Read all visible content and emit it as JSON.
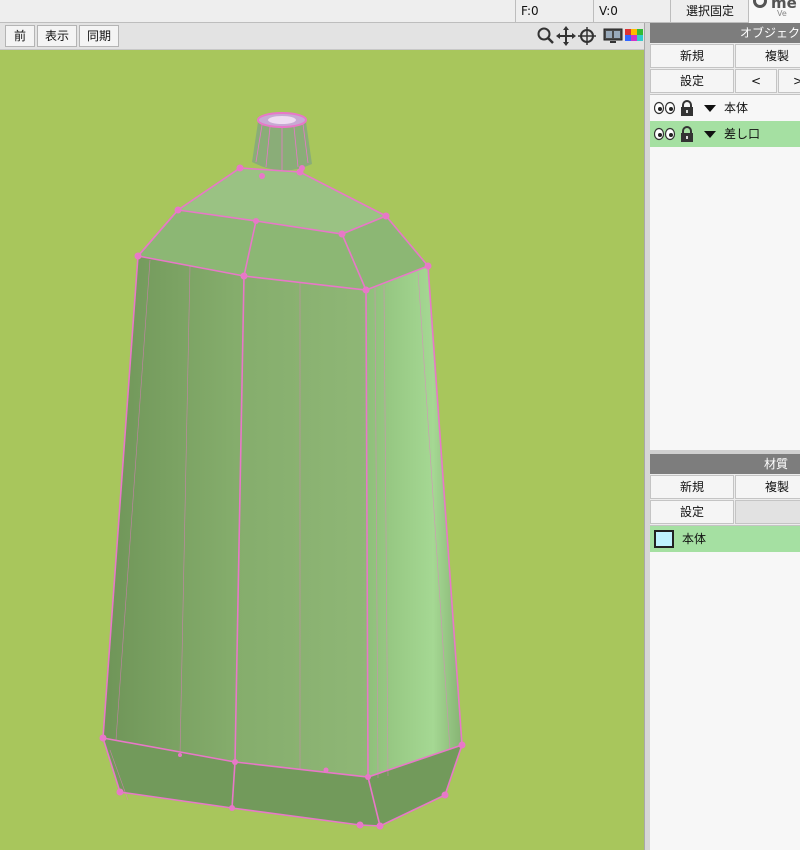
{
  "status_bar": {
    "faces": "F:0",
    "vertices": "V:0",
    "select_lock": "選択固定",
    "logo_text": "me",
    "logo_sub": "Ve"
  },
  "view_toolbar": {
    "prev_label": "前",
    "display_label": "表示",
    "sync_label": "同期",
    "icons": [
      "zoom-icon",
      "move-icon",
      "rotate-icon",
      "screen-icon",
      "color-icon"
    ]
  },
  "viewport": {
    "background": "#a8c65c",
    "mesh_color": "#8fc07c",
    "wire_color": "#e878c8"
  },
  "object_panel": {
    "title": "オブジェク",
    "new_label": "新規",
    "duplicate_label": "複製",
    "settings_label": "設定",
    "prev_label": "<",
    "next_label": ">",
    "items": [
      {
        "name": "本体",
        "selected": false
      },
      {
        "name": "差し口",
        "selected": true
      }
    ]
  },
  "material_panel": {
    "title": "材質",
    "new_label": "新規",
    "duplicate_label": "複製",
    "settings_label": "設定",
    "items": [
      {
        "name": "本体",
        "color": "#bff3ff",
        "selected": true
      }
    ]
  }
}
